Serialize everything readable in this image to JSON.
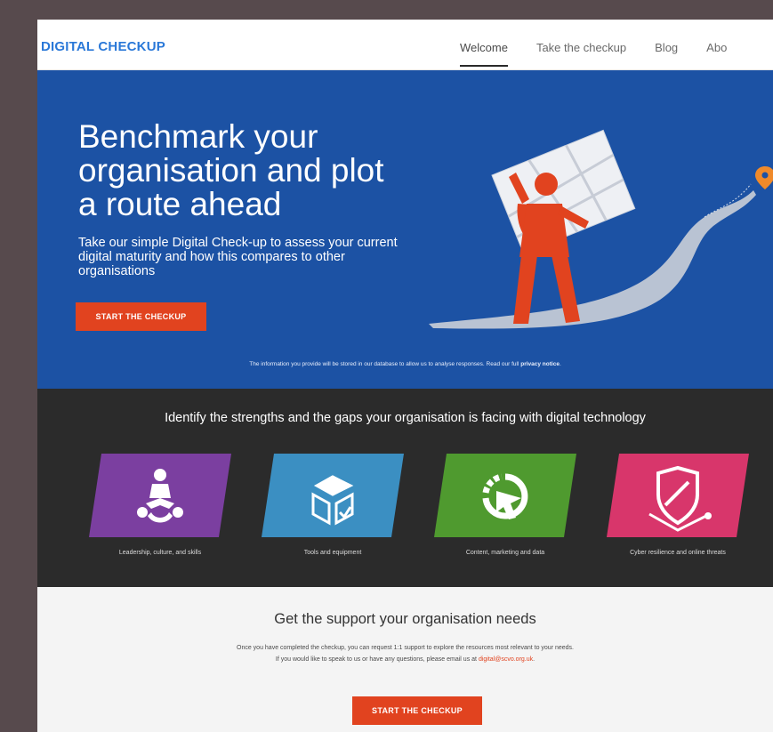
{
  "nav": {
    "brand": "DIGITAL CHECKUP",
    "links": [
      "Welcome",
      "Take the checkup",
      "Blog",
      "Abo"
    ]
  },
  "hero": {
    "title": "Benchmark your organisation and plot a route ahead",
    "subtitle": "Take our simple Digital Check-up to assess your current digital maturity and how this compares to other organisations",
    "button": "START THE CHECKUP",
    "note_prefix": "The information you provide will be stored in our database to allow us to analyse responses. Read our full",
    "note_link": "privacy notice",
    "note_suffix": ".",
    "illustration_icon": "person-carrying-map-icon"
  },
  "strengths": {
    "title": "Identify the strengths and the gaps your organisation is facing with digital technology",
    "tiles": [
      {
        "label": "Leadership, culture, and skills",
        "icon": "people-network-icon",
        "color": "#7b3fa0"
      },
      {
        "label": "Tools and equipment",
        "icon": "box-tools-icon",
        "color": "#3b8fc2"
      },
      {
        "label": "Content, marketing and data",
        "icon": "cursor-chart-icon",
        "color": "#4f9a2f"
      },
      {
        "label": "Cyber resilience and online threats",
        "icon": "shield-icon",
        "color": "#d8366b"
      }
    ]
  },
  "support": {
    "title": "Get the support your organisation needs",
    "line1": "Once you have completed the checkup, you can request 1:1 support to explore the resources most relevant to your needs.",
    "line2_prefix": "If you would like to speak to us or have any questions, please email us at",
    "email": "digital@scvo.org.uk",
    "line2_suffix": ".",
    "button": "START THE CHECKUP"
  },
  "colors": {
    "accent": "#e1431f",
    "hero_bg": "#1c52a4",
    "dark_bg": "#2b2b2b",
    "brand": "#2a78d8"
  }
}
